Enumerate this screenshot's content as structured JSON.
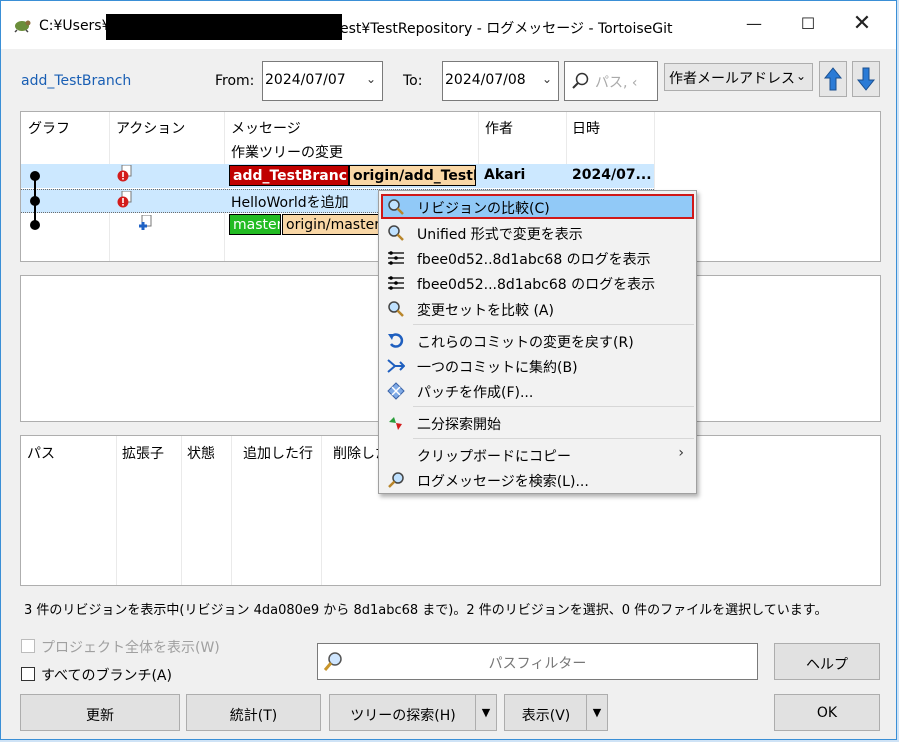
{
  "window": {
    "title_prefix": "C:¥Users¥",
    "title_suffix": "est¥TestRepository - ログメッセージ - TortoiseGit"
  },
  "toolbar": {
    "branch_link": "add_TestBranch",
    "from_label": "From:",
    "from_date": "2024/07/07",
    "to_label": "To:",
    "to_date": "2024/07/08",
    "search_placeholder": "パス, ‹",
    "filter_by": "作者メールアドレス"
  },
  "log": {
    "columns": [
      "グラフ",
      "アクション",
      "メッセージ",
      "作者",
      "日時"
    ],
    "rows": [
      {
        "message": "作業ツリーの変更",
        "author": "",
        "date": ""
      },
      {
        "refs": [
          "add_TestBranch",
          "origin/add_TestBr"
        ],
        "author": "Akari",
        "date": "2024/07..."
      },
      {
        "message": "HelloWorldを追加",
        "author": "",
        "date": ""
      },
      {
        "refs": [
          "master",
          "origin/master"
        ],
        "author": "",
        "date": ""
      }
    ]
  },
  "files": {
    "columns": [
      "パス",
      "拡張子",
      "状態",
      "追加した行",
      "削除した"
    ]
  },
  "status_text": "3 件のリビジョンを表示中(リビジョン 4da080e9 から 8d1abc68 まで)。2 件のリビジョンを選択、0 件のファイルを選択しています。",
  "options": {
    "show_whole_project": "プロジェクト全体を表示(W)",
    "all_branches": "すべてのブランチ(A)"
  },
  "path_filter_placeholder": "パスフィルター",
  "buttons": {
    "help": "ヘルプ",
    "refresh": "更新",
    "stats": "統計(T)",
    "tree_walk": "ツリーの探索(H)",
    "view": "表示(V)",
    "ok": "OK"
  },
  "context_menu": {
    "items": [
      {
        "label": "リビジョンの比較(C)",
        "icon": "magnifier-icon"
      },
      {
        "label": "Unified 形式で変更を表示",
        "icon": "magnifier-icon"
      },
      {
        "label": "fbee0d52..8d1abc68 のログを表示",
        "icon": "log-icon"
      },
      {
        "label": "fbee0d52...8d1abc68 のログを表示",
        "icon": "log-icon"
      },
      {
        "label": "変更セットを比較 (A)",
        "icon": "magnifier-icon"
      },
      {
        "label": "これらのコミットの変更を戻す(R)",
        "icon": "revert-icon"
      },
      {
        "label": "一つのコミットに集約(B)",
        "icon": "squash-icon"
      },
      {
        "label": "パッチを作成(F)...",
        "icon": "patch-icon"
      },
      {
        "label": "二分探索開始",
        "icon": "bisect-icon"
      },
      {
        "label": "クリップボードにコピー",
        "icon": "",
        "submenu_arrow": "›"
      },
      {
        "label": "ログメッセージを検索(L)...",
        "icon": "search-log-icon"
      }
    ]
  },
  "colors": {
    "branch_local": "#c00000",
    "branch_remote": "#f9d7a6",
    "master": "#22bb22",
    "selection": "#cce8ff",
    "menu_highlight": "#91c9f7"
  }
}
